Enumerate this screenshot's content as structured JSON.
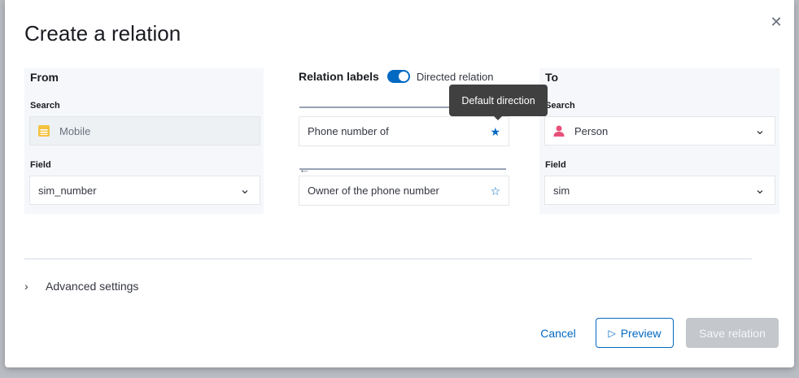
{
  "dialog": {
    "title": "Create a relation",
    "close_icon": "close-icon"
  },
  "from": {
    "title": "From",
    "search_label": "Search",
    "search_value": "Mobile",
    "search_icon": "mobile-type-icon",
    "field_label": "Field",
    "field_value": "sim_number"
  },
  "middle": {
    "relation_labels": "Relation labels",
    "directed_label": "Directed relation",
    "directed_on": true,
    "forward_label": "Phone number of",
    "backward_label": "Owner of the phone number",
    "tooltip": "Default direction"
  },
  "to": {
    "title": "To",
    "search_label": "Search",
    "search_value": "Person",
    "search_icon": "person-icon",
    "field_label": "Field",
    "field_value": "sim"
  },
  "advanced": {
    "label": "Advanced settings"
  },
  "footer": {
    "cancel": "Cancel",
    "preview": "Preview",
    "save": "Save relation"
  },
  "colors": {
    "accent": "#0069c2",
    "person_icon": "#e7507a",
    "mobile_icon": "#f3c23e",
    "disabled_button": "#c4c7cc"
  }
}
